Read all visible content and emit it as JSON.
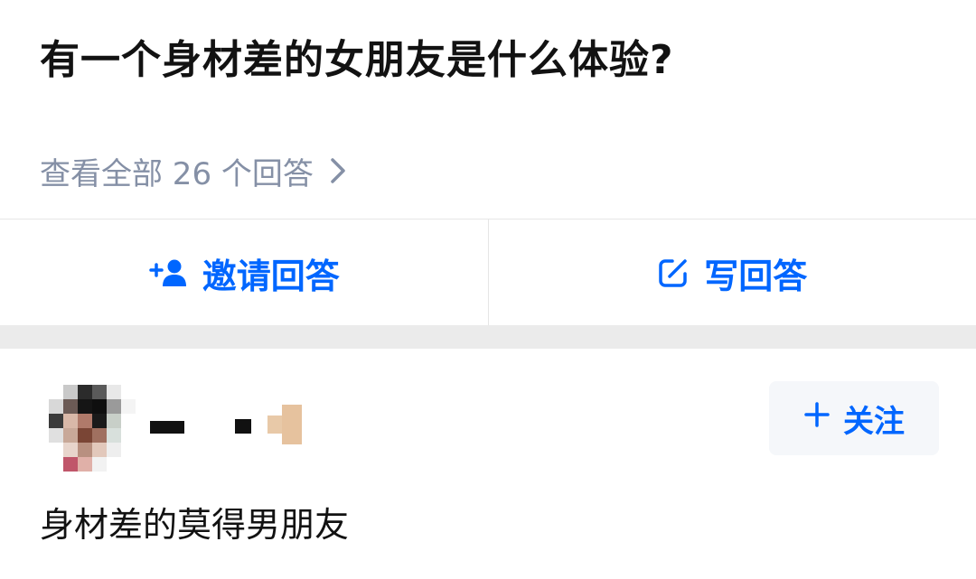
{
  "question": {
    "title": "有一个身材差的女朋友是什么体验?",
    "view_all_label": "查看全部 26 个回答"
  },
  "actions": {
    "invite_label": "邀请回答",
    "write_label": "写回答"
  },
  "answer": {
    "follow_label": "关注",
    "excerpt": "身材差的莫得男朋友"
  },
  "colors": {
    "accent": "#0066ff",
    "muted_text": "#8590a6",
    "primary_text": "#121212",
    "separator": "#ebebeb"
  },
  "icons": {
    "view_all": "chevron-right-icon",
    "invite": "add-person-icon",
    "write": "edit-icon",
    "follow": "plus-icon"
  }
}
